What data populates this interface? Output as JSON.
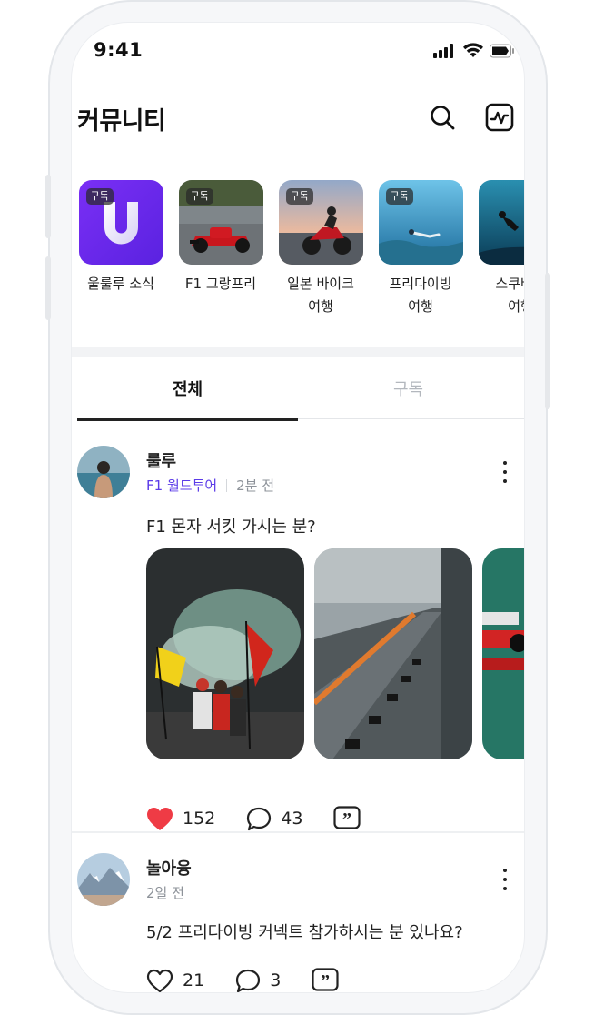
{
  "status_bar": {
    "time": "9:41"
  },
  "header": {
    "title": "커뮤니티"
  },
  "channels": [
    {
      "badge": "구독",
      "name": "울룰루 소식"
    },
    {
      "badge": "구독",
      "name": "F1 그랑프리"
    },
    {
      "badge": "구독",
      "name": "일본 바이크\n여행"
    },
    {
      "badge": "구독",
      "name": "프리다이빙\n여행"
    },
    {
      "badge": "",
      "name": "스쿠버다\n여행"
    }
  ],
  "tabs": [
    {
      "label": "전체",
      "active": true
    },
    {
      "label": "구독",
      "active": false
    }
  ],
  "posts": [
    {
      "author": "룰루",
      "community": "F1 월드투어",
      "time": "2분 전",
      "text": "F1 몬자 서킷 가시는 분?",
      "likes": "152",
      "comments": "43",
      "liked": true
    },
    {
      "author": "놀아융",
      "community": "",
      "time": "2일 전",
      "text": "5/2 프리다이빙 커넥트 참가하시는 분 있나요?",
      "likes": "21",
      "comments": "3",
      "liked": false
    }
  ],
  "colors": {
    "accent": "#5b3be8",
    "like": "#ef3b45",
    "brand_channel": "#6b2bf0"
  }
}
